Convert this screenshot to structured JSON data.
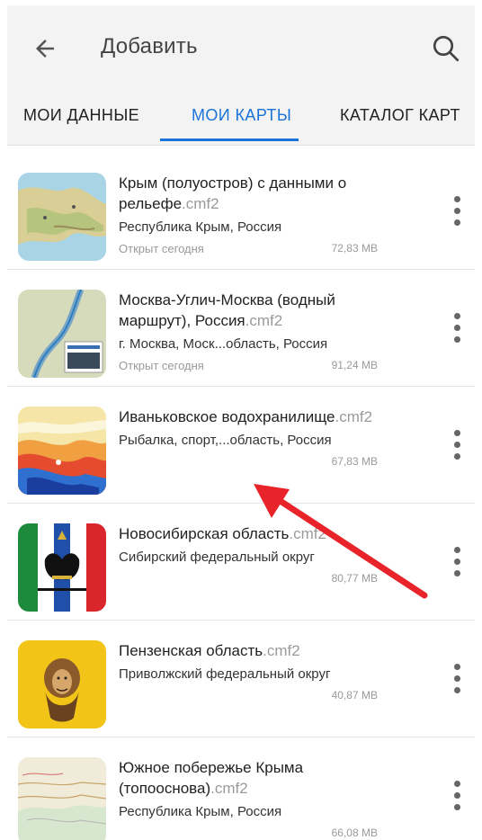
{
  "header": {
    "title": "Добавить",
    "back_icon": "arrow-left-icon",
    "search_icon": "search-icon"
  },
  "tabs": [
    {
      "label": "МОИ ДАННЫЕ",
      "active": false
    },
    {
      "label": "МОИ КАРТЫ",
      "active": true
    },
    {
      "label": "КАТАЛОГ КАРТ",
      "active": false
    }
  ],
  "colors": {
    "accent": "#1a73d9",
    "annotation_arrow": "#e8232a",
    "appbar_bg": "#f3f3f3"
  },
  "maps": [
    {
      "name": "Крым (полуостров) с данными о рельефе",
      "ext": ".cmf2",
      "subtitle": "Республика Крым, Россия",
      "opened": "Открыт сегодня",
      "size": "72,83 MB",
      "thumb_icon": "crimea-relief-map-thumbnail"
    },
    {
      "name": "Москва-Углич-Москва (водный маршрут), Россия",
      "ext": ".cmf2",
      "subtitle": "г. Москва, Моск...область, Россия",
      "opened": "Открыт сегодня",
      "size": "91,24 MB",
      "thumb_icon": "moscow-uglich-route-map-thumbnail"
    },
    {
      "name": "Иваньковское водохранилище",
      "ext": ".cmf2",
      "subtitle": "Рыбалка, спорт,...область, Россия",
      "opened": "",
      "size": "67,83 MB",
      "thumb_icon": "ivankovo-reservoir-depth-map-thumbnail"
    },
    {
      "name": "Новосибирская область",
      "ext": ".cmf2",
      "subtitle": "Сибирский федеральный округ",
      "opened": "",
      "size": "80,77 MB",
      "thumb_icon": "novosibirsk-coat-of-arms-icon"
    },
    {
      "name": "Пензенская область",
      "ext": ".cmf2",
      "subtitle": "Приволжский федеральный округ",
      "opened": "",
      "size": "40,87 MB",
      "thumb_icon": "penza-coat-of-arms-icon"
    },
    {
      "name": "Южное побережье Крыма (топооснова)",
      "ext": ".cmf2",
      "subtitle": "Республика Крым, Россия",
      "opened": "",
      "size": "66,08 MB",
      "thumb_icon": "south-coast-crimea-topo-map-thumbnail"
    }
  ]
}
